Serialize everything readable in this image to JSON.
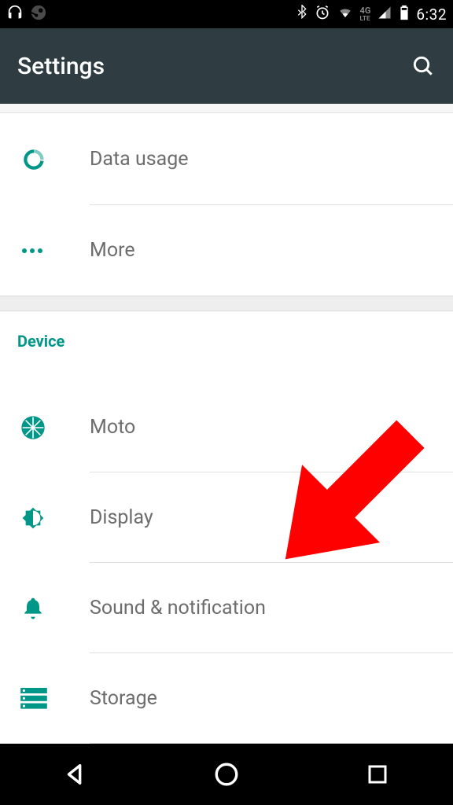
{
  "statusbar": {
    "time": "6:32",
    "network_label": "4G LTE"
  },
  "appbar": {
    "title": "Settings"
  },
  "items_network": [
    {
      "icon": "data-usage-icon",
      "label": "Data usage"
    },
    {
      "icon": "more-icon",
      "label": "More"
    }
  ],
  "section_device_header": "Device",
  "items_device": [
    {
      "icon": "moto-icon",
      "label": "Moto"
    },
    {
      "icon": "display-icon",
      "label": "Display"
    },
    {
      "icon": "bell-icon",
      "label": "Sound & notification"
    },
    {
      "icon": "storage-icon",
      "label": "Storage"
    }
  ],
  "colors": {
    "accent": "#009688",
    "statusbar_bg": "#000000",
    "appbar_bg": "#2f3c42",
    "arrow": "#ff0000"
  }
}
